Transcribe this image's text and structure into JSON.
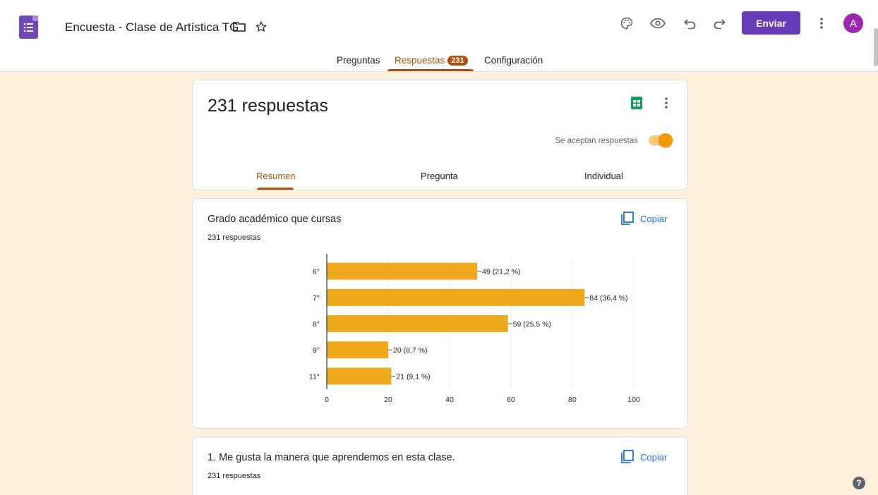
{
  "header": {
    "doc_title": "Encuesta - Clase de Artística TG",
    "send_label": "Enviar",
    "avatar_letter": "A",
    "icons": [
      "forms-logo-icon",
      "folder-icon",
      "star-icon",
      "palette-icon",
      "preview-eye-icon",
      "undo-icon",
      "redo-icon",
      "more-vert-icon"
    ]
  },
  "tabs": [
    {
      "label": "Preguntas"
    },
    {
      "label": "Respuestas",
      "badge": "231",
      "active": true
    },
    {
      "label": "Configuración"
    }
  ],
  "summary": {
    "count_text": "231 respuestas",
    "accepting_label": "Se aceptan respuestas",
    "accepting": true,
    "subtabs": [
      {
        "label": "Resumen",
        "active": true
      },
      {
        "label": "Pregunta"
      },
      {
        "label": "Individual"
      }
    ]
  },
  "questions": [
    {
      "title": "Grado académico que cursas",
      "responses": "231 respuestas",
      "copy_label": "Copiar"
    },
    {
      "title": "1. Me gusta la manera que aprendemos en esta clase.",
      "responses": "231 respuestas",
      "copy_label": "Copiar"
    }
  ],
  "colors": {
    "accent": "#b0500c",
    "primary": "#673ab7",
    "bar": "#f0a81c",
    "background": "#fdf0dc"
  },
  "chart_data": {
    "type": "bar",
    "orientation": "horizontal",
    "categories": [
      "6°",
      "7°",
      "8°",
      "9°",
      "11°"
    ],
    "values": [
      49,
      84,
      59,
      20,
      21
    ],
    "data_labels": [
      "49 (21,2 %)",
      "84 (36,4 %)",
      "59 (25,5 %)",
      "20 (8,7 %)",
      "21 (9,1 %)"
    ],
    "xlim": [
      0,
      100
    ],
    "xticks": [
      "0",
      "20",
      "40",
      "60",
      "80",
      "100"
    ],
    "grid": true
  }
}
